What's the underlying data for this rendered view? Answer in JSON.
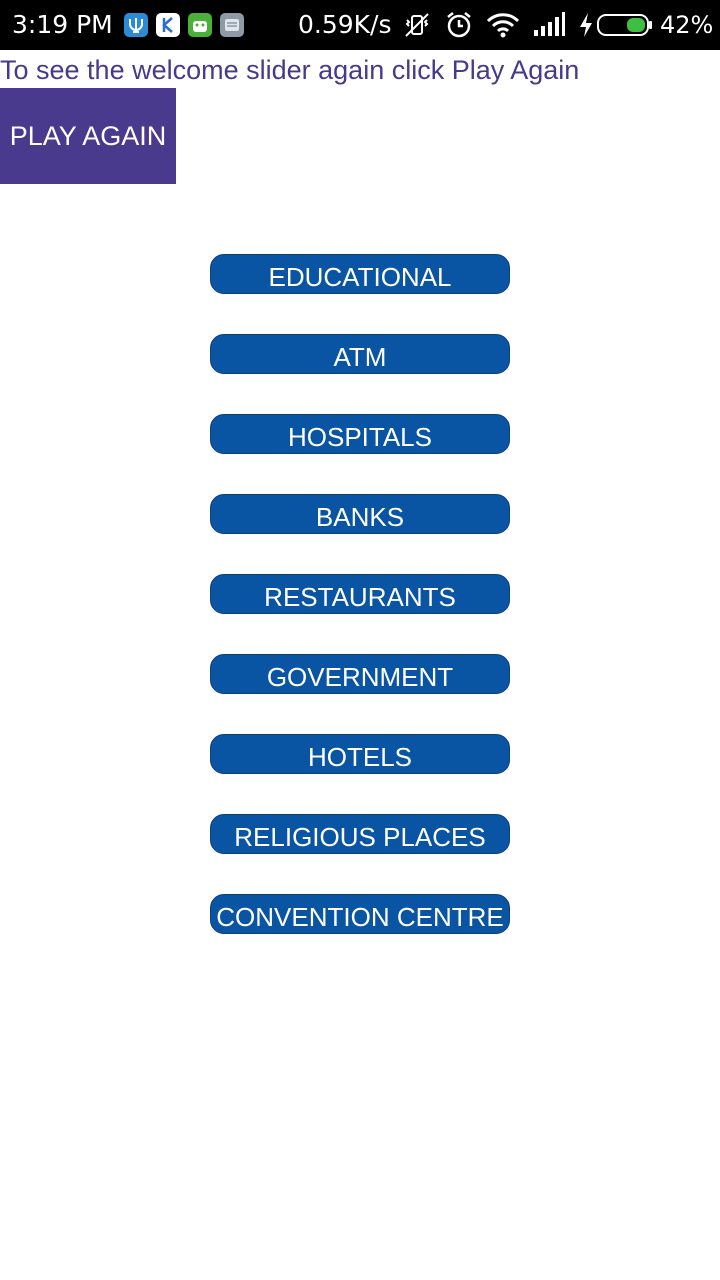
{
  "status_bar": {
    "time": "3:19  PM",
    "net_speed": "0.59K/s",
    "battery": "42%",
    "notification_icons": [
      "trident-app-icon",
      "k-app-icon",
      "android-app-icon",
      "message-app-icon"
    ],
    "system_icons": [
      "vibrate-off-icon",
      "alarm-icon",
      "wifi-icon",
      "signal-icon",
      "charging-icon",
      "battery-icon"
    ]
  },
  "intro": {
    "text": "To see the welcome slider again click Play Again"
  },
  "play_again": {
    "label": "PLAY AGAIN"
  },
  "categories": [
    {
      "label": "EDUCATIONAL"
    },
    {
      "label": "ATM"
    },
    {
      "label": "HOSPITALS"
    },
    {
      "label": "BANKS"
    },
    {
      "label": "RESTAURANTS"
    },
    {
      "label": "GOVERNMENT"
    },
    {
      "label": "HOTELS"
    },
    {
      "label": "RELIGIOUS PLACES"
    },
    {
      "label": "CONVENTION CENTRE"
    }
  ],
  "colors": {
    "status_bar_bg": "#000000",
    "accent_purple": "#4a3a8e",
    "category_button": "#0a55a3",
    "battery_fill": "#3fbf3f"
  }
}
